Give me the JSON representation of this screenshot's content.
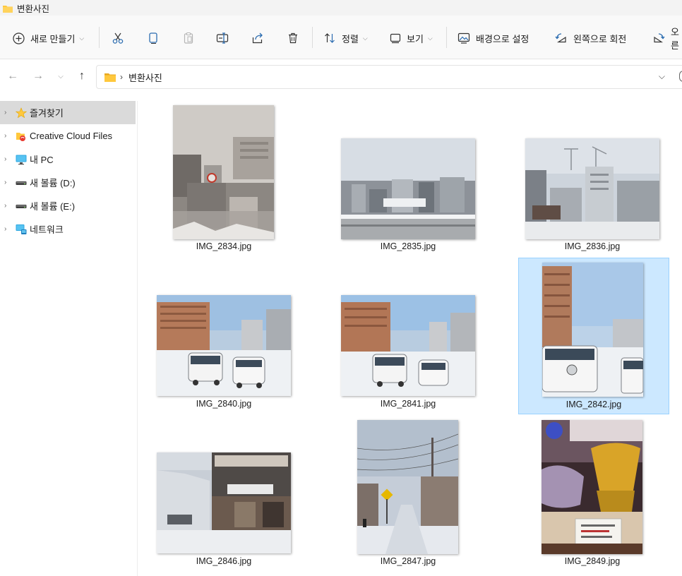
{
  "window": {
    "title": "변환사진"
  },
  "toolbar": {
    "new_label": "새로 만들기",
    "sort_label": "정렬",
    "view_label": "보기",
    "set_background_label": "배경으로 설정",
    "rotate_left_label": "왼쪽으로 회전",
    "rotate_right_label": "오른"
  },
  "address": {
    "crumb": "변환사진",
    "separator": "›"
  },
  "navpane": {
    "items": [
      {
        "label": "즐겨찾기",
        "icon": "star-icon"
      },
      {
        "label": "Creative Cloud Files",
        "icon": "creative-cloud-icon"
      },
      {
        "label": "내 PC",
        "icon": "monitor-icon"
      },
      {
        "label": "새 볼륨 (D:)",
        "icon": "drive-icon"
      },
      {
        "label": "새 볼륨 (E:)",
        "icon": "drive-icon"
      },
      {
        "label": "네트워크",
        "icon": "network-icon"
      }
    ]
  },
  "files": [
    {
      "name": "IMG_2834.jpg",
      "orientation": "portrait",
      "scene": "snowy-city"
    },
    {
      "name": "IMG_2835.jpg",
      "orientation": "landscape",
      "scene": "city-rooftops"
    },
    {
      "name": "IMG_2836.jpg",
      "orientation": "landscape",
      "scene": "city-cranes"
    },
    {
      "name": "IMG_2840.jpg",
      "orientation": "landscape",
      "scene": "street-vans"
    },
    {
      "name": "IMG_2841.jpg",
      "orientation": "landscape",
      "scene": "street-vans"
    },
    {
      "name": "IMG_2842.jpg",
      "orientation": "portrait",
      "scene": "street-van-portrait",
      "selected": true
    },
    {
      "name": "IMG_2846.jpg",
      "orientation": "landscape",
      "scene": "shopfront"
    },
    {
      "name": "IMG_2847.jpg",
      "orientation": "portrait",
      "scene": "snow-street"
    },
    {
      "name": "IMG_2849.jpg",
      "orientation": "portrait",
      "scene": "glass-display"
    }
  ],
  "colors": {
    "selection_bg": "#cce8ff",
    "selection_border": "#99d1ff",
    "nav_selected": "#dadada",
    "folder_yellow": "#ffc83d"
  }
}
